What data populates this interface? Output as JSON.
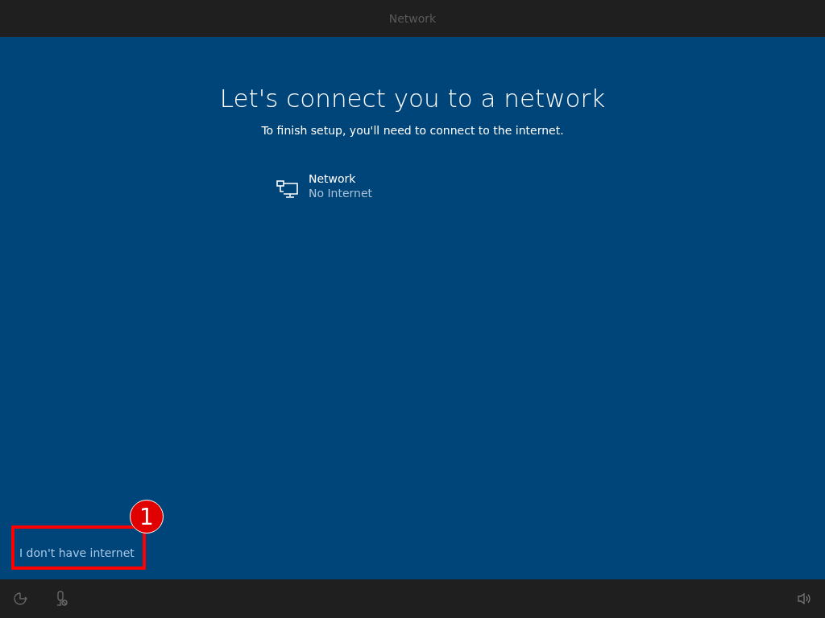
{
  "top_bar": {
    "title": "Network"
  },
  "heading": "Let's connect you to a network",
  "subtitle": "To finish setup, you'll need to connect to the internet.",
  "networks": [
    {
      "name": "Network",
      "status": "No Internet"
    }
  ],
  "skip_link": "I don't have internet",
  "annotation": {
    "badge": "1"
  }
}
